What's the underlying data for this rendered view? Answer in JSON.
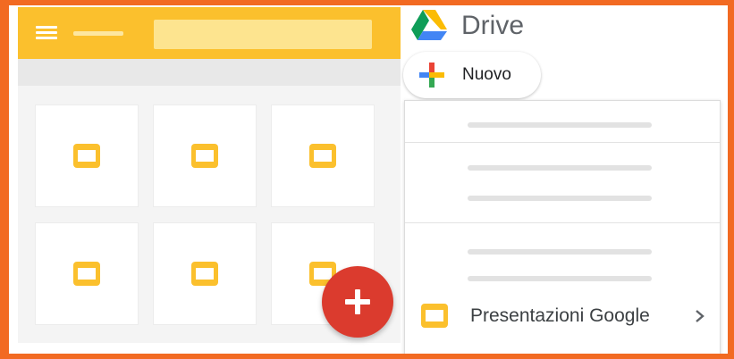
{
  "colors": {
    "background_border": "#f26a22",
    "app_header": "#fbc02d",
    "slides_yellow": "#fbc02d",
    "fab_red": "#db3b2e",
    "drive_text": "#5f6368"
  },
  "left_app": {
    "menu_icon": "hamburger-icon",
    "tile_icon": "slides-icon",
    "fab_icon": "plus-icon"
  },
  "drive": {
    "title": "Drive",
    "logo_icon": "google-drive-icon",
    "new_button": {
      "label": "Nuovo",
      "icon": "google-plus-icon"
    },
    "menu": {
      "selected_item": {
        "label": "Presentazioni Google",
        "icon": "slides-icon",
        "submenu_icon": "chevron-right-icon"
      }
    }
  }
}
